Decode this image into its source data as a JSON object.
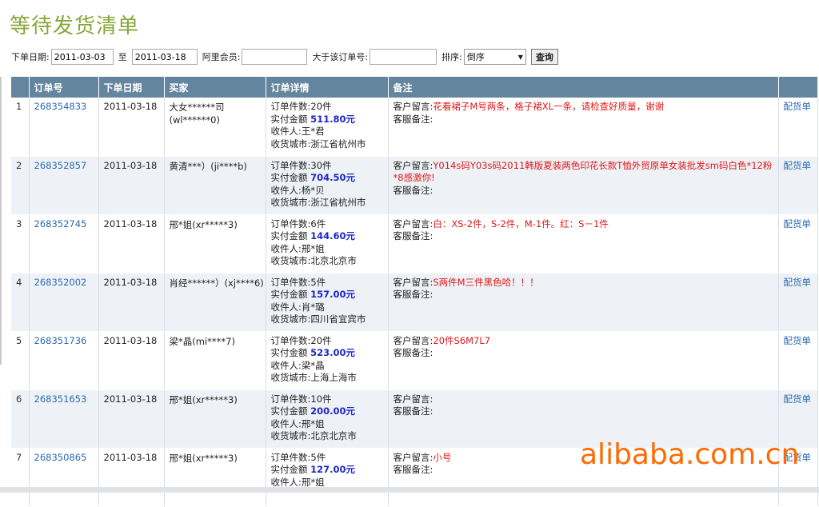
{
  "page": {
    "title": "等待发货清单"
  },
  "filters": {
    "date_label": "下单日期:",
    "date_from": "2011-03-03",
    "to_label": "至",
    "date_to": "2011-03-18",
    "member_label": "阿里会员:",
    "member_value": "",
    "order_gt_label": "大于该订单号:",
    "order_gt_value": "",
    "sort_label": "排序:",
    "sort_value": "倒序",
    "query_button": "查询"
  },
  "table": {
    "headers": [
      "订单号",
      "下单日期",
      "买家",
      "订单详情",
      "备注",
      ""
    ],
    "rows": [
      {
        "idx": "1",
        "order_no": "268354833",
        "date": "2011-03-18",
        "buyer_line1": "大女******司",
        "buyer_line2": "(wl******0)",
        "qty": "订单件数:20件",
        "amount_label": "实付金额",
        "amount": "511.80元",
        "receiver": "收件人:王*君",
        "city": "收货城市:浙江省杭州市",
        "cust_label": "客户留言:",
        "cust_msg": "花看裙子M号两条，格子裙XL一条，请检查好质量，谢谢",
        "svc_label": "客服备注:",
        "action": "配货单"
      },
      {
        "idx": "2",
        "order_no": "268352857",
        "date": "2011-03-18",
        "buyer_line1": "黄清***）(ji****b)",
        "buyer_line2": "",
        "qty": "订单件数:30件",
        "amount_label": "实付金额",
        "amount": "704.50元",
        "receiver": "收件人:杨*贝",
        "city": "收货城市:浙江省杭州市",
        "cust_label": "客户留言:",
        "cust_msg": "Y014s码Y03s码2011韩版夏装两色印花长款T恤外贸原单女装批发sm码白色*12粉*8感激你!",
        "svc_label": "客服备注:",
        "action": "配货单"
      },
      {
        "idx": "3",
        "order_no": "268352745",
        "date": "2011-03-18",
        "buyer_line1": "邢*姐(xr*****3)",
        "buyer_line2": "",
        "qty": "订单件数:6件",
        "amount_label": "实付金额",
        "amount": "144.60元",
        "receiver": "收件人:邢*姐",
        "city": "收货城市:北京北京市",
        "cust_label": "客户留言:",
        "cust_msg": "白：XS-2件，S-2件，M-1件。红：S－1件",
        "svc_label": "客服备注:",
        "action": "配货单"
      },
      {
        "idx": "4",
        "order_no": "268352002",
        "date": "2011-03-18",
        "buyer_line1": "肖经******）(xj****6)",
        "buyer_line2": "",
        "qty": "订单件数:5件",
        "amount_label": "实付金额",
        "amount": "157.00元",
        "receiver": "收件人:肖*璐",
        "city": "收货城市:四川省宜宾市",
        "cust_label": "客户留言:",
        "cust_msg": "S两件M三件黑色哈！！！",
        "svc_label": "客服备注:",
        "action": "配货单"
      },
      {
        "idx": "5",
        "order_no": "268351736",
        "date": "2011-03-18",
        "buyer_line1": "梁*晶(mi****7)",
        "buyer_line2": "",
        "qty": "订单件数:20件",
        "amount_label": "实付金额",
        "amount": "523.00元",
        "receiver": "收件人:梁*晶",
        "city": "收货城市:上海上海市",
        "cust_label": "客户留言:",
        "cust_msg": "20件S6M7L7",
        "svc_label": "客服备注:",
        "action": "配货单"
      },
      {
        "idx": "6",
        "order_no": "268351653",
        "date": "2011-03-18",
        "buyer_line1": "邢*姐(xr*****3)",
        "buyer_line2": "",
        "qty": "订单件数:10件",
        "amount_label": "实付金额",
        "amount": "200.00元",
        "receiver": "收件人:邢*姐",
        "city": "收货城市:北京北京市",
        "cust_label": "客户留言:",
        "cust_msg": "",
        "svc_label": "客服备注:",
        "action": "配货单"
      },
      {
        "idx": "7",
        "order_no": "268350865",
        "date": "2011-03-18",
        "buyer_line1": "邢*姐(xr*****3)",
        "buyer_line2": "",
        "qty": "订单件数:5件",
        "amount_label": "实付金额",
        "amount": "127.00元",
        "receiver": "收件人:邢*姐",
        "city": "",
        "cust_label": "客户留言:",
        "cust_msg": "小号",
        "svc_label": "客服备注:",
        "action": "配货单"
      }
    ]
  },
  "watermark": "alibaba.com.cn"
}
